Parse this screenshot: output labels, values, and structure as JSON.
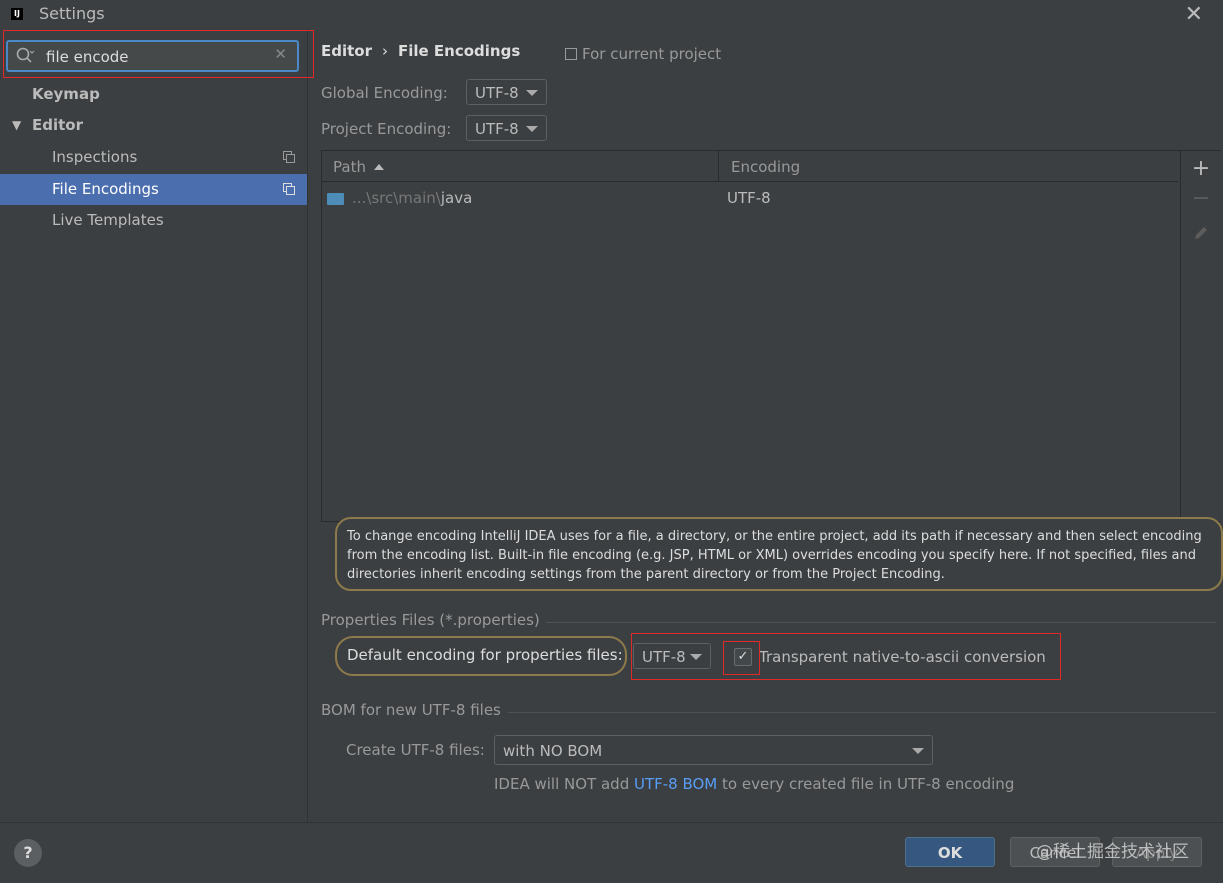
{
  "window": {
    "title": "Settings",
    "app_icon": "intellij-idea-icon"
  },
  "sidebar": {
    "search": {
      "value": "file encode",
      "icon": "search-icon"
    },
    "items": [
      {
        "label": "Keymap"
      },
      {
        "label": "Editor",
        "expanded": true
      },
      {
        "label": "Inspections"
      },
      {
        "label": "File Encodings",
        "selected": true
      },
      {
        "label": "Live Templates"
      }
    ]
  },
  "header": {
    "breadcrumb_parent": "Editor",
    "breadcrumb_sep": "›",
    "breadcrumb_current": "File Encodings",
    "for_current_project": "For current project"
  },
  "encodings": {
    "global_label": "Global Encoding:",
    "global_value": "UTF-8",
    "project_label": "Project Encoding:",
    "project_value": "UTF-8"
  },
  "table": {
    "col_path": "Path",
    "col_encoding": "Encoding",
    "rows": [
      {
        "path_prefix": "...\\src\\main\\",
        "path_tail": "java",
        "encoding": "UTF-8"
      }
    ]
  },
  "info_text": "To change encoding IntelliJ IDEA uses for a file, a directory, or the entire project, add its path if necessary and then select encoding from the encoding list. Built-in file encoding (e.g. JSP, HTML or XML) overrides encoding you specify here. If not specified, files and directories inherit encoding settings from the parent directory or from the Project Encoding.",
  "properties": {
    "section_title": "Properties Files (*.properties)",
    "default_label": "Default encoding for properties files:",
    "default_value": "UTF-8",
    "transparent_label": "Transparent native-to-ascii conversion",
    "transparent_checked": true
  },
  "bom": {
    "section_title": "BOM for new UTF-8 files",
    "create_label": "Create UTF-8 files:",
    "create_value": "with NO BOM",
    "note_prefix": "IDEA will NOT add ",
    "note_link": "UTF-8 BOM",
    "note_suffix": " to every created file in UTF-8 encoding"
  },
  "buttons": {
    "help": "?",
    "ok": "OK",
    "cancel": "Cancel",
    "apply": "Apply"
  },
  "watermark": "@稀土掘金技术社区",
  "colors": {
    "selection": "#4b6eaf",
    "accent_link": "#589df6",
    "highlight_border": "#e02a2a",
    "hint_border": "#8d7a4a"
  }
}
